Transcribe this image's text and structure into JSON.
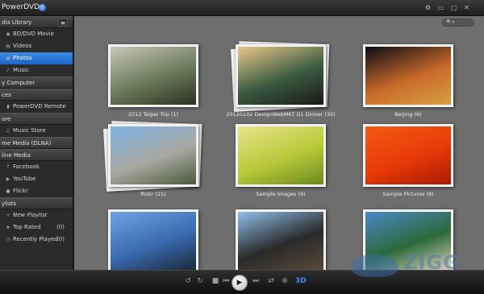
{
  "app": {
    "title": "PowerDVD"
  },
  "window": {
    "settings": "⚙",
    "minimize": "▭",
    "maximize": "▢",
    "close": "✕"
  },
  "sidebar": {
    "media_library": {
      "label": "dia Library",
      "toggle": "≡",
      "items": [
        {
          "label": "BD/DVD Movie",
          "icon": "disc-icon",
          "glyph": "◉"
        },
        {
          "label": "Videos",
          "icon": "video-icon",
          "glyph": "▤"
        },
        {
          "label": "Photos",
          "icon": "photo-icon",
          "glyph": "▣",
          "selected": true
        },
        {
          "label": "Music",
          "icon": "music-icon",
          "glyph": "♪"
        }
      ]
    },
    "my_computer": {
      "label": "y Computer"
    },
    "devices": {
      "label": "ces",
      "items": [
        {
          "label": "PowerDVD Remote",
          "icon": "remote-icon",
          "glyph": "▮"
        }
      ]
    },
    "store": {
      "label": "ore",
      "items": [
        {
          "label": "Music Store",
          "icon": "store-icon",
          "glyph": "♫"
        }
      ]
    },
    "home_media": {
      "label": "me Media (DLNA)"
    },
    "online_media": {
      "label": "line Media",
      "items": [
        {
          "label": "Facebook",
          "icon": "facebook-icon",
          "glyph": "f"
        },
        {
          "label": "YouTube",
          "icon": "youtube-icon",
          "glyph": "▶"
        },
        {
          "label": "Flickr",
          "icon": "flickr-icon",
          "glyph": "●"
        }
      ]
    },
    "playlists": {
      "label": "ylists",
      "items": [
        {
          "label": "New Playlist",
          "icon": "add-playlist-icon",
          "glyph": "+",
          "count": ""
        },
        {
          "label": "Top Rated",
          "icon": "star-icon",
          "glyph": "★",
          "count": "(0)"
        },
        {
          "label": "Recently Played",
          "icon": "clock-icon",
          "glyph": "◷",
          "count": "(0)"
        }
      ]
    }
  },
  "search": {
    "glyph": "🔍▾"
  },
  "gallery": [
    {
      "caption": "2012 Taipei Trip (1)",
      "colors": [
        "#c8c6b8",
        "#6a7a5a",
        "#2c3020"
      ],
      "stacked": false
    },
    {
      "caption": "20120102 DesignWebMKT Q1 Dinner (30)",
      "colors": [
        "#e8c88a",
        "#3a5a40",
        "#1a1a14"
      ],
      "stacked": true
    },
    {
      "caption": "Beijing (6)",
      "colors": [
        "#0c0c14",
        "#c86a2a",
        "#d8a040"
      ],
      "stacked": false
    },
    {
      "caption": "flickr (21)",
      "colors": [
        "#7fb3e6",
        "#a8a8a0",
        "#4a5a3a"
      ],
      "stacked": true
    },
    {
      "caption": "Sample Images (6)",
      "colors": [
        "#e8e48a",
        "#b8c838",
        "#6a8a20"
      ],
      "stacked": false
    },
    {
      "caption": "Sample Pictures (8)",
      "colors": [
        "#f25a14",
        "#e83a08",
        "#a81c04"
      ],
      "stacked": false
    },
    {
      "caption": "",
      "colors": [
        "#6ea4e2",
        "#3a6ab0",
        "#1a2a3a"
      ],
      "stacked": false
    },
    {
      "caption": "",
      "colors": [
        "#8ec0ec",
        "#2a2a2a",
        "#5a4a3a"
      ],
      "stacked": false
    },
    {
      "caption": "",
      "colors": [
        "#4a88c8",
        "#2c6a3a",
        "#d8d0c0"
      ],
      "stacked": false
    }
  ],
  "transport": {
    "undo": "↺",
    "redo": "↻",
    "stop": "■",
    "prev": "⏮",
    "play": "▶",
    "next": "⏭",
    "shuffle": "⇄",
    "zoom": "⊕",
    "mode3d": "3D"
  },
  "watermark": "ZIGG"
}
